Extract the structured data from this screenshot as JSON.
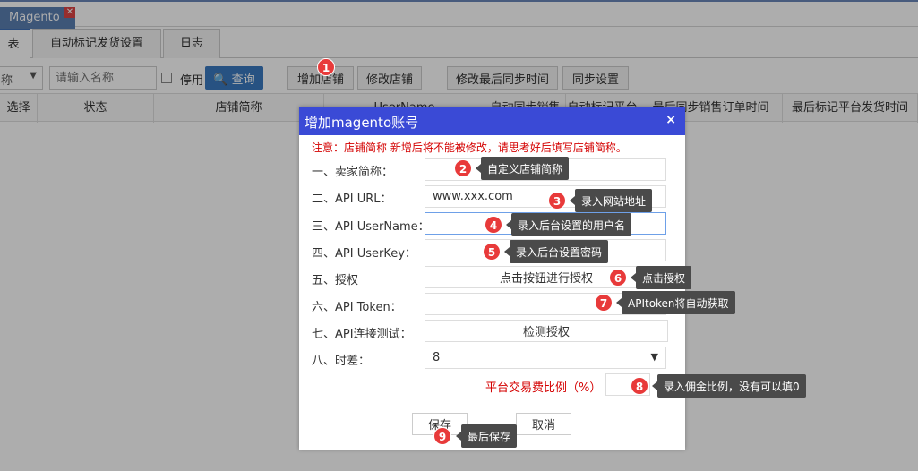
{
  "window": {
    "tab_label": "Magento",
    "close_glyph": "✕"
  },
  "subtabs": [
    "表",
    "自动标记发货设置",
    "日志"
  ],
  "toolbar": {
    "select_value": "称",
    "search_placeholder": "请输入名称",
    "disabled_label": "停用",
    "query_label": "查询",
    "add_store_label": "增加店铺",
    "edit_store_label": "修改店铺",
    "edit_sync_label": "修改最后同步时间",
    "sync_settings_label": "同步设置"
  },
  "table": {
    "headers": [
      "选择",
      "状态",
      "店铺简称",
      "UserName",
      "自动同步销售",
      "自动标记平台",
      "最后同步销售订单时间",
      "最后标记平台发货时间"
    ]
  },
  "dialog": {
    "title": "增加magento账号",
    "close_glyph": "×",
    "notice": "注意：店铺简称 新增后将不能被修改，请思考好后填写店铺简称。",
    "rows": {
      "seller_name_label": "一、卖家简称：",
      "api_url_label": "二、API URL：",
      "api_url_value": "www.xxx.com",
      "api_username_label": "三、API UserName：",
      "api_userkey_label": "四、API UserKey：",
      "authorize_label": "五、授权",
      "authorize_button": "点击按钮进行授权",
      "api_token_label": "六、API Token：",
      "api_test_label": "七、API连接测试：",
      "api_test_button": "检测授权",
      "timezone_label": "八、时差：",
      "timezone_value": "8",
      "fee_label": "平台交易费比例（%）"
    },
    "save_label": "保存",
    "cancel_label": "取消"
  },
  "callouts": {
    "n1": "1",
    "n2": "2",
    "t2": "自定义店铺简称",
    "n3": "3",
    "t3": "录入网站地址",
    "n4": "4",
    "t4": "录入后台设置的用户名",
    "n5": "5",
    "t5": "录入后台设置密码",
    "n6": "6",
    "t6": "点击授权",
    "n7": "7",
    "t7": "APItoken将自动获取",
    "n8": "8",
    "t8": "录入佣金比例，没有可以填0",
    "n9": "9",
    "t9": "最后保存"
  },
  "colors": {
    "dialog_header": "#3a4ad6",
    "callout_badge": "#e83a3a",
    "callout_tip": "#4a4a4a",
    "notice_text": "#d40000"
  }
}
